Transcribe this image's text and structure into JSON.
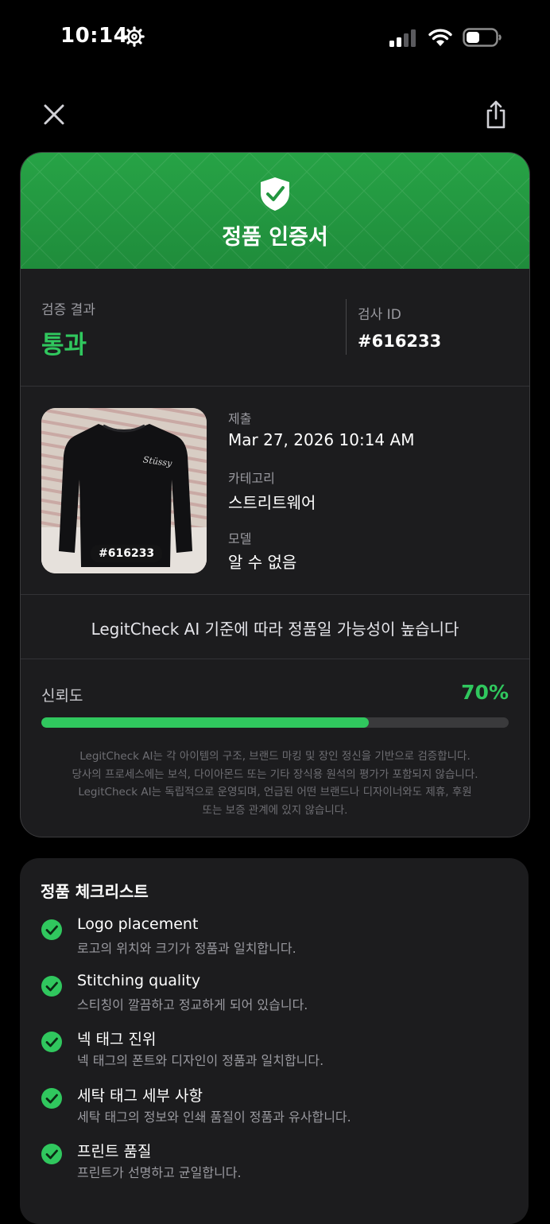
{
  "status_bar": {
    "time": "10:14",
    "settings_icon": "gear-icon",
    "signal_icon": "cellular-signal-icon",
    "wifi_icon": "wifi-icon",
    "battery_icon": "battery-icon"
  },
  "nav": {
    "close_icon": "close-icon",
    "share_icon": "share-icon"
  },
  "certificate": {
    "title": "정품 인증서",
    "shield_icon": "shield-check-icon",
    "result_label": "검증 결과",
    "result_value": "통과",
    "id_label": "검사 ID",
    "id_value": "#616233",
    "photo_tag": "#616233",
    "meta": [
      {
        "label": "제출",
        "value": "Mar 27, 2026 10:14 AM"
      },
      {
        "label": "카테고리",
        "value": "스트리트웨어"
      },
      {
        "label": "모델",
        "value": "알 수 없음"
      }
    ],
    "likely_text": "LegitCheck AI 기준에 따라 정품일 가능성이 높습니다",
    "confidence_label": "신뢰도",
    "confidence_value": "70%",
    "confidence_fraction": 0.7,
    "disclaimer": [
      "LegitCheck AI는 각 아이템의 구조, 브랜드 마킹 및 장인 정신을 기반으로 검증합니다.",
      "당사의 프로세스에는 보석, 다이아몬드 또는 기타 장식용 원석의 평가가 포함되지 않습니다.",
      "LegitCheck AI는 독립적으로 운영되며, 언급된 어떤 브랜드나 디자이너와도 제휴, 후원",
      "또는 보증 관계에 있지 않습니다."
    ]
  },
  "checklist": {
    "title": "정품 체크리스트",
    "items": [
      {
        "name": "Logo placement",
        "desc": "로고의 위치와 크기가 정품과 일치합니다."
      },
      {
        "name": "Stitching quality",
        "desc": "스티칭이 깔끔하고 정교하게 되어 있습니다."
      },
      {
        "name": "넥 태그 진위",
        "desc": "넥 태그의 폰트와 디자인이 정품과 일치합니다."
      },
      {
        "name": "세탁 태그 세부 사항",
        "desc": "세탁 태그의 정보와 인쇄 품질이 정품과 유사합니다."
      },
      {
        "name": "프린트 품질",
        "desc": "프린트가 선명하고 균일합니다."
      }
    ]
  },
  "colors": {
    "accent_green": "#30c75e",
    "header_green": "#27a346",
    "card_bg": "#1c1c1e",
    "page_bg": "#000000"
  }
}
